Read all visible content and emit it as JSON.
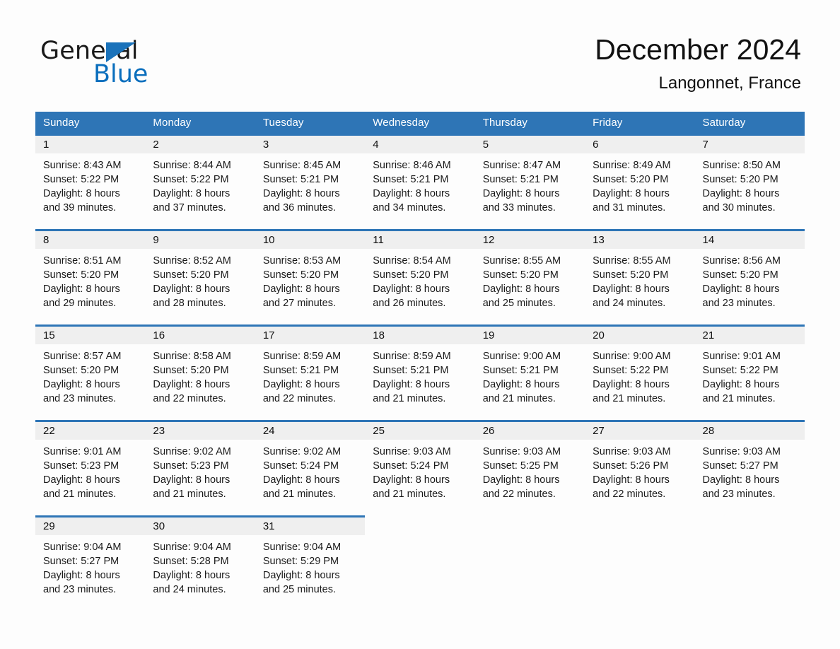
{
  "brand": {
    "name_part1": "General",
    "name_part2": "Blue",
    "triangle_color": "#1a72ba",
    "blue_color": "#0a6ebd"
  },
  "header": {
    "month_title": "December 2024",
    "location": "Langonnet, France"
  },
  "calendar": {
    "header_bg": "#2e75b6",
    "day_band_bg": "#efefef",
    "weekdays": [
      "Sunday",
      "Monday",
      "Tuesday",
      "Wednesday",
      "Thursday",
      "Friday",
      "Saturday"
    ],
    "weeks": [
      [
        {
          "day": "1",
          "sunrise": "Sunrise: 8:43 AM",
          "sunset": "Sunset: 5:22 PM",
          "daylight_line1": "Daylight: 8 hours",
          "daylight_line2": "and 39 minutes."
        },
        {
          "day": "2",
          "sunrise": "Sunrise: 8:44 AM",
          "sunset": "Sunset: 5:22 PM",
          "daylight_line1": "Daylight: 8 hours",
          "daylight_line2": "and 37 minutes."
        },
        {
          "day": "3",
          "sunrise": "Sunrise: 8:45 AM",
          "sunset": "Sunset: 5:21 PM",
          "daylight_line1": "Daylight: 8 hours",
          "daylight_line2": "and 36 minutes."
        },
        {
          "day": "4",
          "sunrise": "Sunrise: 8:46 AM",
          "sunset": "Sunset: 5:21 PM",
          "daylight_line1": "Daylight: 8 hours",
          "daylight_line2": "and 34 minutes."
        },
        {
          "day": "5",
          "sunrise": "Sunrise: 8:47 AM",
          "sunset": "Sunset: 5:21 PM",
          "daylight_line1": "Daylight: 8 hours",
          "daylight_line2": "and 33 minutes."
        },
        {
          "day": "6",
          "sunrise": "Sunrise: 8:49 AM",
          "sunset": "Sunset: 5:20 PM",
          "daylight_line1": "Daylight: 8 hours",
          "daylight_line2": "and 31 minutes."
        },
        {
          "day": "7",
          "sunrise": "Sunrise: 8:50 AM",
          "sunset": "Sunset: 5:20 PM",
          "daylight_line1": "Daylight: 8 hours",
          "daylight_line2": "and 30 minutes."
        }
      ],
      [
        {
          "day": "8",
          "sunrise": "Sunrise: 8:51 AM",
          "sunset": "Sunset: 5:20 PM",
          "daylight_line1": "Daylight: 8 hours",
          "daylight_line2": "and 29 minutes."
        },
        {
          "day": "9",
          "sunrise": "Sunrise: 8:52 AM",
          "sunset": "Sunset: 5:20 PM",
          "daylight_line1": "Daylight: 8 hours",
          "daylight_line2": "and 28 minutes."
        },
        {
          "day": "10",
          "sunrise": "Sunrise: 8:53 AM",
          "sunset": "Sunset: 5:20 PM",
          "daylight_line1": "Daylight: 8 hours",
          "daylight_line2": "and 27 minutes."
        },
        {
          "day": "11",
          "sunrise": "Sunrise: 8:54 AM",
          "sunset": "Sunset: 5:20 PM",
          "daylight_line1": "Daylight: 8 hours",
          "daylight_line2": "and 26 minutes."
        },
        {
          "day": "12",
          "sunrise": "Sunrise: 8:55 AM",
          "sunset": "Sunset: 5:20 PM",
          "daylight_line1": "Daylight: 8 hours",
          "daylight_line2": "and 25 minutes."
        },
        {
          "day": "13",
          "sunrise": "Sunrise: 8:55 AM",
          "sunset": "Sunset: 5:20 PM",
          "daylight_line1": "Daylight: 8 hours",
          "daylight_line2": "and 24 minutes."
        },
        {
          "day": "14",
          "sunrise": "Sunrise: 8:56 AM",
          "sunset": "Sunset: 5:20 PM",
          "daylight_line1": "Daylight: 8 hours",
          "daylight_line2": "and 23 minutes."
        }
      ],
      [
        {
          "day": "15",
          "sunrise": "Sunrise: 8:57 AM",
          "sunset": "Sunset: 5:20 PM",
          "daylight_line1": "Daylight: 8 hours",
          "daylight_line2": "and 23 minutes."
        },
        {
          "day": "16",
          "sunrise": "Sunrise: 8:58 AM",
          "sunset": "Sunset: 5:20 PM",
          "daylight_line1": "Daylight: 8 hours",
          "daylight_line2": "and 22 minutes."
        },
        {
          "day": "17",
          "sunrise": "Sunrise: 8:59 AM",
          "sunset": "Sunset: 5:21 PM",
          "daylight_line1": "Daylight: 8 hours",
          "daylight_line2": "and 22 minutes."
        },
        {
          "day": "18",
          "sunrise": "Sunrise: 8:59 AM",
          "sunset": "Sunset: 5:21 PM",
          "daylight_line1": "Daylight: 8 hours",
          "daylight_line2": "and 21 minutes."
        },
        {
          "day": "19",
          "sunrise": "Sunrise: 9:00 AM",
          "sunset": "Sunset: 5:21 PM",
          "daylight_line1": "Daylight: 8 hours",
          "daylight_line2": "and 21 minutes."
        },
        {
          "day": "20",
          "sunrise": "Sunrise: 9:00 AM",
          "sunset": "Sunset: 5:22 PM",
          "daylight_line1": "Daylight: 8 hours",
          "daylight_line2": "and 21 minutes."
        },
        {
          "day": "21",
          "sunrise": "Sunrise: 9:01 AM",
          "sunset": "Sunset: 5:22 PM",
          "daylight_line1": "Daylight: 8 hours",
          "daylight_line2": "and 21 minutes."
        }
      ],
      [
        {
          "day": "22",
          "sunrise": "Sunrise: 9:01 AM",
          "sunset": "Sunset: 5:23 PM",
          "daylight_line1": "Daylight: 8 hours",
          "daylight_line2": "and 21 minutes."
        },
        {
          "day": "23",
          "sunrise": "Sunrise: 9:02 AM",
          "sunset": "Sunset: 5:23 PM",
          "daylight_line1": "Daylight: 8 hours",
          "daylight_line2": "and 21 minutes."
        },
        {
          "day": "24",
          "sunrise": "Sunrise: 9:02 AM",
          "sunset": "Sunset: 5:24 PM",
          "daylight_line1": "Daylight: 8 hours",
          "daylight_line2": "and 21 minutes."
        },
        {
          "day": "25",
          "sunrise": "Sunrise: 9:03 AM",
          "sunset": "Sunset: 5:24 PM",
          "daylight_line1": "Daylight: 8 hours",
          "daylight_line2": "and 21 minutes."
        },
        {
          "day": "26",
          "sunrise": "Sunrise: 9:03 AM",
          "sunset": "Sunset: 5:25 PM",
          "daylight_line1": "Daylight: 8 hours",
          "daylight_line2": "and 22 minutes."
        },
        {
          "day": "27",
          "sunrise": "Sunrise: 9:03 AM",
          "sunset": "Sunset: 5:26 PM",
          "daylight_line1": "Daylight: 8 hours",
          "daylight_line2": "and 22 minutes."
        },
        {
          "day": "28",
          "sunrise": "Sunrise: 9:03 AM",
          "sunset": "Sunset: 5:27 PM",
          "daylight_line1": "Daylight: 8 hours",
          "daylight_line2": "and 23 minutes."
        }
      ],
      [
        {
          "day": "29",
          "sunrise": "Sunrise: 9:04 AM",
          "sunset": "Sunset: 5:27 PM",
          "daylight_line1": "Daylight: 8 hours",
          "daylight_line2": "and 23 minutes."
        },
        {
          "day": "30",
          "sunrise": "Sunrise: 9:04 AM",
          "sunset": "Sunset: 5:28 PM",
          "daylight_line1": "Daylight: 8 hours",
          "daylight_line2": "and 24 minutes."
        },
        {
          "day": "31",
          "sunrise": "Sunrise: 9:04 AM",
          "sunset": "Sunset: 5:29 PM",
          "daylight_line1": "Daylight: 8 hours",
          "daylight_line2": "and 25 minutes."
        },
        {
          "day": "",
          "sunrise": "",
          "sunset": "",
          "daylight_line1": "",
          "daylight_line2": ""
        },
        {
          "day": "",
          "sunrise": "",
          "sunset": "",
          "daylight_line1": "",
          "daylight_line2": ""
        },
        {
          "day": "",
          "sunrise": "",
          "sunset": "",
          "daylight_line1": "",
          "daylight_line2": ""
        },
        {
          "day": "",
          "sunrise": "",
          "sunset": "",
          "daylight_line1": "",
          "daylight_line2": ""
        }
      ]
    ]
  }
}
